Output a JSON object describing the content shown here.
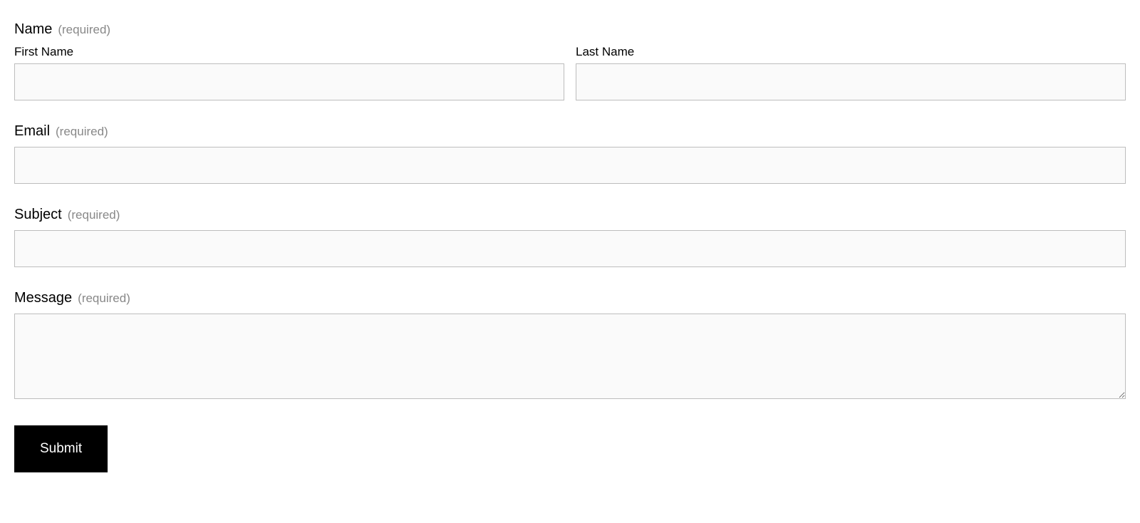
{
  "form": {
    "name": {
      "label": "Name",
      "required_text": "(required)",
      "first_name_label": "First Name",
      "last_name_label": "Last Name",
      "first_name_value": "",
      "last_name_value": ""
    },
    "email": {
      "label": "Email",
      "required_text": "(required)",
      "value": ""
    },
    "subject": {
      "label": "Subject",
      "required_text": "(required)",
      "value": ""
    },
    "message": {
      "label": "Message",
      "required_text": "(required)",
      "value": ""
    },
    "submit_label": "Submit"
  }
}
